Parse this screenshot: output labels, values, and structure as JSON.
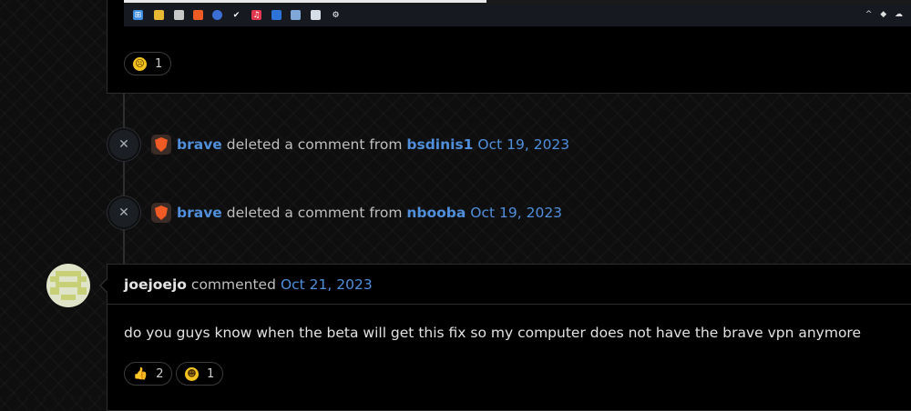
{
  "top_comment": {
    "reaction": {
      "emoji": "confused-face",
      "count": "1"
    },
    "taskbar_icons": [
      "windows-icon",
      "file-explorer-icon",
      "store-icon",
      "brave-browser-icon",
      "generic-app-icon",
      "steam-icon",
      "music-app-icon",
      "notes-icon",
      "paint-icon",
      "mail-icon",
      "settings-icon"
    ]
  },
  "events": [
    {
      "actor": "brave",
      "action": "deleted a comment from",
      "target": "bsdinis1",
      "date": "Oct 19, 2023"
    },
    {
      "actor": "brave",
      "action": "deleted a comment from",
      "target": "nbooba",
      "date": "Oct 19, 2023"
    }
  ],
  "comment": {
    "author": "joejoejo",
    "action": "commented",
    "date": "Oct 21, 2023",
    "body": "do you guys know when the beta will get this fix so my computer does not have the brave vpn anymore",
    "reactions": [
      {
        "emoji": "thumbs-up",
        "count": "2"
      },
      {
        "emoji": "grinning-face",
        "count": "1"
      }
    ]
  },
  "colors": {
    "link": "#4f8fdb",
    "emoji": "#f4c21f",
    "brave": "#f05a24"
  }
}
